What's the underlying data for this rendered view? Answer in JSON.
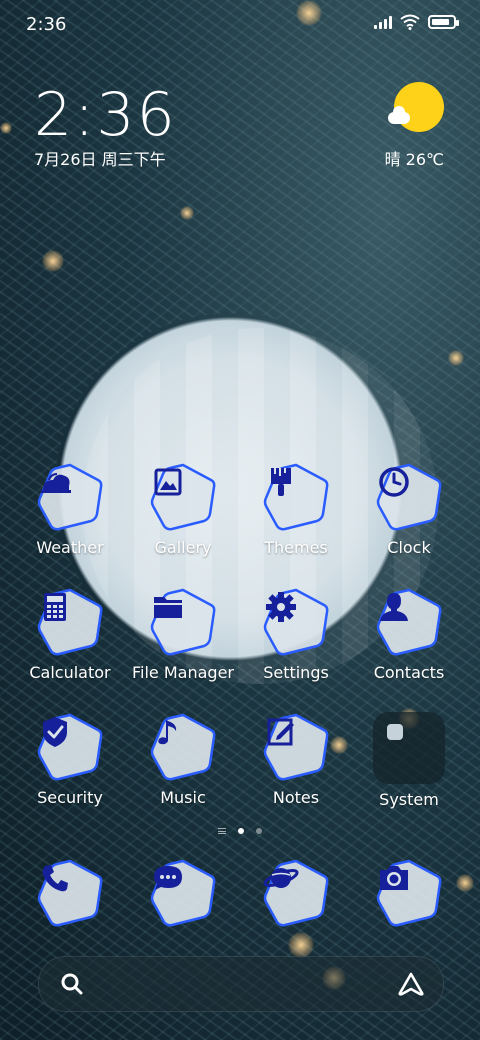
{
  "status_bar": {
    "time": "2:36",
    "battery_level": 0.85
  },
  "clock_widget": {
    "time": "2:36",
    "date": "7月26日 周三下午"
  },
  "weather_widget": {
    "icon": "sun-cloud-icon",
    "text": "晴 26℃"
  },
  "apps": [
    {
      "label": "Weather",
      "icon": "weather-icon"
    },
    {
      "label": "Gallery",
      "icon": "gallery-icon"
    },
    {
      "label": "Themes",
      "icon": "themes-brush-icon"
    },
    {
      "label": "Clock",
      "icon": "clock-icon"
    },
    {
      "label": "Calculator",
      "icon": "calculator-icon"
    },
    {
      "label": "File Manager",
      "icon": "folder-icon"
    },
    {
      "label": "Settings",
      "icon": "gear-icon"
    },
    {
      "label": "Contacts",
      "icon": "person-icon"
    },
    {
      "label": "Security",
      "icon": "shield-check-icon"
    },
    {
      "label": "Music",
      "icon": "music-note-icon"
    },
    {
      "label": "Notes",
      "icon": "note-pencil-icon"
    },
    {
      "label": "System",
      "icon": "folder-icon"
    }
  ],
  "page_indicator": {
    "pages": 2,
    "current": 1
  },
  "dock": [
    {
      "name": "phone",
      "icon": "phone-icon"
    },
    {
      "name": "messages",
      "icon": "chat-bubble-icon"
    },
    {
      "name": "browser",
      "icon": "planet-icon"
    },
    {
      "name": "camera",
      "icon": "camera-icon"
    }
  ],
  "search_bar": {
    "left_icon": "search-icon",
    "right_icon": "assistant-icon"
  },
  "colors": {
    "icon_fill": "#15209a",
    "icon_border": "#2a5cff",
    "tile_bg": "#dbe4ea",
    "sun": "#ffd21a"
  }
}
